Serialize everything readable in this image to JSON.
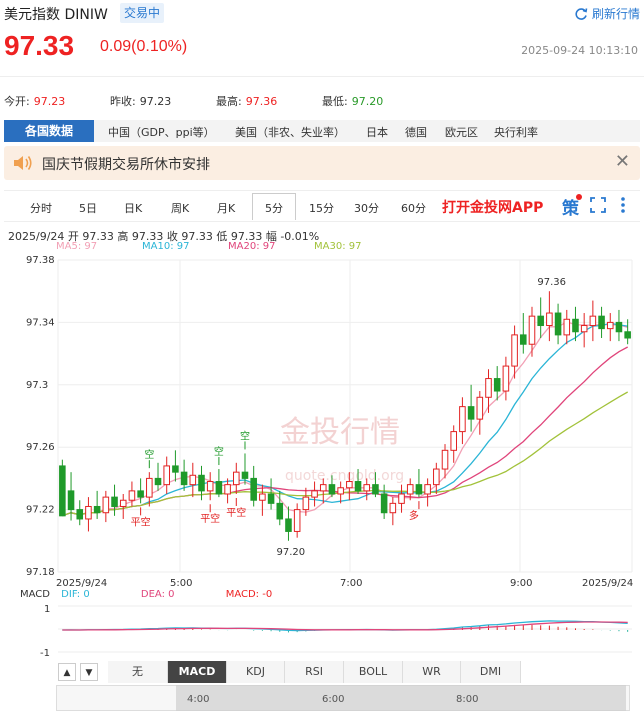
{
  "header": {
    "title": "美元指数 DINIW",
    "status": "交易中",
    "refresh_label": "刷新行情",
    "price": "97.33",
    "change": "0.09(0.10%)",
    "timestamp": "2025-09-24 10:13:10"
  },
  "stats": [
    {
      "label": "今开:",
      "value": "97.23"
    },
    {
      "label": "昨收:",
      "value": "97.23"
    },
    {
      "label": "最高:",
      "value": "97.36"
    },
    {
      "label": "最低:",
      "value": "97.20"
    }
  ],
  "country_tabs": {
    "active": "各国数据",
    "items": [
      "中国（GDP、ppi等）",
      "美国（非农、失业率）",
      "日本",
      "德国",
      "欧元区",
      "央行利率"
    ]
  },
  "notice": {
    "text": "国庆节假期交易所休市安排",
    "close": "✕"
  },
  "periods": {
    "items": [
      "分时",
      "5日",
      "日K",
      "周K",
      "月K",
      "5分",
      "15分",
      "30分",
      "60分"
    ],
    "active": "5分",
    "app_link": "打开金投网APP",
    "strategy_label": "策"
  },
  "ohlc": "2025/9/24  开 97.33  高 97.33  收 97.33  低 97.33  幅 -0.01%",
  "ma_legend": [
    {
      "label": "MA5: 97",
      "color": "#f2a0b5"
    },
    {
      "label": "MA10: 97",
      "color": "#2bb5d6"
    },
    {
      "label": "MA20: 97",
      "color": "#e0457b"
    },
    {
      "label": "MA30: 97",
      "color": "#a2c23a"
    }
  ],
  "watermark": {
    "text": "金投行情",
    "sub": "quote.cngold.org"
  },
  "chart_data": {
    "type": "candlestick",
    "y_ticks": [
      "97.38",
      "97.34",
      "97.3",
      "97.26",
      "97.22",
      "97.18"
    ],
    "ylim": [
      97.18,
      97.38
    ],
    "x_ticks": [
      "2025/9/24",
      "5:00",
      "7:00",
      "9:00",
      "2025/9/24"
    ],
    "high_label": "97.36",
    "low_label": "97.20",
    "signals": {
      "buy": "空",
      "sell": "平空",
      "long": "多"
    },
    "colors": {
      "up": "#e22222",
      "down": "#1f9a2a"
    },
    "candles": [
      [
        97.248,
        97.252,
        97.228,
        97.216
      ],
      [
        97.232,
        97.244,
        97.213,
        97.22
      ],
      [
        97.22,
        97.226,
        97.21,
        97.214
      ],
      [
        97.214,
        97.228,
        97.206,
        97.222
      ],
      [
        97.222,
        97.232,
        97.214,
        97.218
      ],
      [
        97.218,
        97.232,
        97.212,
        97.228
      ],
      [
        97.228,
        97.236,
        97.216,
        97.222
      ],
      [
        97.222,
        97.23,
        97.214,
        97.226
      ],
      [
        97.226,
        97.238,
        97.222,
        97.232
      ],
      [
        97.232,
        97.24,
        97.224,
        97.228
      ],
      [
        97.228,
        97.244,
        97.222,
        97.24
      ],
      [
        97.24,
        97.25,
        97.232,
        97.236
      ],
      [
        97.236,
        97.254,
        97.23,
        97.248
      ],
      [
        97.248,
        97.258,
        97.238,
        97.244
      ],
      [
        97.244,
        97.252,
        97.232,
        97.236
      ],
      [
        97.236,
        97.25,
        97.228,
        97.242
      ],
      [
        97.242,
        97.248,
        97.226,
        97.232
      ],
      [
        97.232,
        97.244,
        97.226,
        97.238
      ],
      [
        97.238,
        97.246,
        97.228,
        97.23
      ],
      [
        97.23,
        97.24,
        97.224,
        97.236
      ],
      [
        97.236,
        97.25,
        97.23,
        97.244
      ],
      [
        97.244,
        97.256,
        97.236,
        97.24
      ],
      [
        97.24,
        97.248,
        97.222,
        97.226
      ],
      [
        97.226,
        97.236,
        97.216,
        97.23
      ],
      [
        97.23,
        97.24,
        97.22,
        97.224
      ],
      [
        97.224,
        97.232,
        97.21,
        97.214
      ],
      [
        97.214,
        97.222,
        97.2,
        97.206
      ],
      [
        97.206,
        97.224,
        97.202,
        97.22
      ],
      [
        97.22,
        97.234,
        97.216,
        97.228
      ],
      [
        97.228,
        97.238,
        97.222,
        97.232
      ],
      [
        97.232,
        97.24,
        97.224,
        97.236
      ],
      [
        97.236,
        97.242,
        97.228,
        97.23
      ],
      [
        97.23,
        97.238,
        97.224,
        97.234
      ],
      [
        97.234,
        97.244,
        97.226,
        97.238
      ],
      [
        97.238,
        97.246,
        97.23,
        97.232
      ],
      [
        97.232,
        97.24,
        97.226,
        97.236
      ],
      [
        97.236,
        97.244,
        97.228,
        97.23
      ],
      [
        97.23,
        97.236,
        97.214,
        97.218
      ],
      [
        97.218,
        97.228,
        97.21,
        97.224
      ],
      [
        97.224,
        97.236,
        97.218,
        97.23
      ],
      [
        97.23,
        97.24,
        97.226,
        97.236
      ],
      [
        97.236,
        97.246,
        97.228,
        97.23
      ],
      [
        97.23,
        97.24,
        97.222,
        97.236
      ],
      [
        97.236,
        97.25,
        97.23,
        97.246
      ],
      [
        97.246,
        97.262,
        97.24,
        97.258
      ],
      [
        97.258,
        97.274,
        97.25,
        97.27
      ],
      [
        97.27,
        97.292,
        97.262,
        97.286
      ],
      [
        97.286,
        97.3,
        97.27,
        97.278
      ],
      [
        97.278,
        97.296,
        97.268,
        97.292
      ],
      [
        97.292,
        97.31,
        97.282,
        97.304
      ],
      [
        97.304,
        97.312,
        97.29,
        97.296
      ],
      [
        97.296,
        97.318,
        97.29,
        97.312
      ],
      [
        97.312,
        97.338,
        97.304,
        97.332
      ],
      [
        97.332,
        97.346,
        97.32,
        97.326
      ],
      [
        97.326,
        97.35,
        97.318,
        97.344
      ],
      [
        97.344,
        97.356,
        97.33,
        97.338
      ],
      [
        97.338,
        97.36,
        97.328,
        97.346
      ],
      [
        97.346,
        97.352,
        97.326,
        97.332
      ],
      [
        97.332,
        97.348,
        97.326,
        97.342
      ],
      [
        97.342,
        97.35,
        97.328,
        97.334
      ],
      [
        97.334,
        97.346,
        97.324,
        97.338
      ],
      [
        97.338,
        97.354,
        97.328,
        97.344
      ],
      [
        97.344,
        97.35,
        97.33,
        97.336
      ],
      [
        97.336,
        97.346,
        97.328,
        97.34
      ],
      [
        97.34,
        97.348,
        97.328,
        97.334
      ],
      [
        97.334,
        97.342,
        97.326,
        97.33
      ]
    ]
  },
  "macd": {
    "legend": [
      {
        "label": "MACD",
        "color": "#333"
      },
      {
        "label": "DIF: 0",
        "color": "#2bb5d6"
      },
      {
        "label": "DEA: 0",
        "color": "#e0457b"
      },
      {
        "label": "MACD: -0",
        "color": "#e22222"
      }
    ],
    "y_ticks": [
      "1",
      "-1"
    ]
  },
  "indicators": {
    "items": [
      "无",
      "MACD",
      "KDJ",
      "RSI",
      "BOLL",
      "WR",
      "DMI"
    ],
    "active": "MACD",
    "nav": [
      "▲",
      "▼"
    ]
  },
  "range_ticks": [
    "4:00",
    "6:00",
    "8:00"
  ]
}
